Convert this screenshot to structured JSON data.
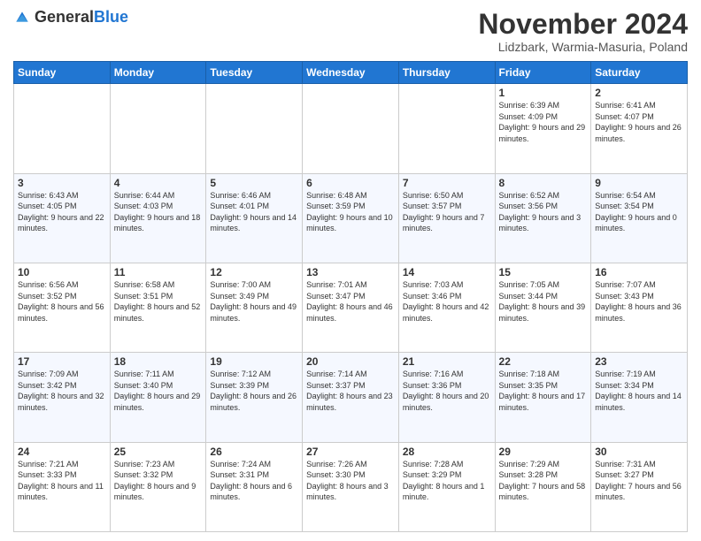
{
  "header": {
    "logo_general": "General",
    "logo_blue": "Blue",
    "month_title": "November 2024",
    "location": "Lidzbark, Warmia-Masuria, Poland"
  },
  "days_of_week": [
    "Sunday",
    "Monday",
    "Tuesday",
    "Wednesday",
    "Thursday",
    "Friday",
    "Saturday"
  ],
  "weeks": [
    [
      {
        "day": "",
        "info": ""
      },
      {
        "day": "",
        "info": ""
      },
      {
        "day": "",
        "info": ""
      },
      {
        "day": "",
        "info": ""
      },
      {
        "day": "",
        "info": ""
      },
      {
        "day": "1",
        "info": "Sunrise: 6:39 AM\nSunset: 4:09 PM\nDaylight: 9 hours and 29 minutes."
      },
      {
        "day": "2",
        "info": "Sunrise: 6:41 AM\nSunset: 4:07 PM\nDaylight: 9 hours and 26 minutes."
      }
    ],
    [
      {
        "day": "3",
        "info": "Sunrise: 6:43 AM\nSunset: 4:05 PM\nDaylight: 9 hours and 22 minutes."
      },
      {
        "day": "4",
        "info": "Sunrise: 6:44 AM\nSunset: 4:03 PM\nDaylight: 9 hours and 18 minutes."
      },
      {
        "day": "5",
        "info": "Sunrise: 6:46 AM\nSunset: 4:01 PM\nDaylight: 9 hours and 14 minutes."
      },
      {
        "day": "6",
        "info": "Sunrise: 6:48 AM\nSunset: 3:59 PM\nDaylight: 9 hours and 10 minutes."
      },
      {
        "day": "7",
        "info": "Sunrise: 6:50 AM\nSunset: 3:57 PM\nDaylight: 9 hours and 7 minutes."
      },
      {
        "day": "8",
        "info": "Sunrise: 6:52 AM\nSunset: 3:56 PM\nDaylight: 9 hours and 3 minutes."
      },
      {
        "day": "9",
        "info": "Sunrise: 6:54 AM\nSunset: 3:54 PM\nDaylight: 9 hours and 0 minutes."
      }
    ],
    [
      {
        "day": "10",
        "info": "Sunrise: 6:56 AM\nSunset: 3:52 PM\nDaylight: 8 hours and 56 minutes."
      },
      {
        "day": "11",
        "info": "Sunrise: 6:58 AM\nSunset: 3:51 PM\nDaylight: 8 hours and 52 minutes."
      },
      {
        "day": "12",
        "info": "Sunrise: 7:00 AM\nSunset: 3:49 PM\nDaylight: 8 hours and 49 minutes."
      },
      {
        "day": "13",
        "info": "Sunrise: 7:01 AM\nSunset: 3:47 PM\nDaylight: 8 hours and 46 minutes."
      },
      {
        "day": "14",
        "info": "Sunrise: 7:03 AM\nSunset: 3:46 PM\nDaylight: 8 hours and 42 minutes."
      },
      {
        "day": "15",
        "info": "Sunrise: 7:05 AM\nSunset: 3:44 PM\nDaylight: 8 hours and 39 minutes."
      },
      {
        "day": "16",
        "info": "Sunrise: 7:07 AM\nSunset: 3:43 PM\nDaylight: 8 hours and 36 minutes."
      }
    ],
    [
      {
        "day": "17",
        "info": "Sunrise: 7:09 AM\nSunset: 3:42 PM\nDaylight: 8 hours and 32 minutes."
      },
      {
        "day": "18",
        "info": "Sunrise: 7:11 AM\nSunset: 3:40 PM\nDaylight: 8 hours and 29 minutes."
      },
      {
        "day": "19",
        "info": "Sunrise: 7:12 AM\nSunset: 3:39 PM\nDaylight: 8 hours and 26 minutes."
      },
      {
        "day": "20",
        "info": "Sunrise: 7:14 AM\nSunset: 3:37 PM\nDaylight: 8 hours and 23 minutes."
      },
      {
        "day": "21",
        "info": "Sunrise: 7:16 AM\nSunset: 3:36 PM\nDaylight: 8 hours and 20 minutes."
      },
      {
        "day": "22",
        "info": "Sunrise: 7:18 AM\nSunset: 3:35 PM\nDaylight: 8 hours and 17 minutes."
      },
      {
        "day": "23",
        "info": "Sunrise: 7:19 AM\nSunset: 3:34 PM\nDaylight: 8 hours and 14 minutes."
      }
    ],
    [
      {
        "day": "24",
        "info": "Sunrise: 7:21 AM\nSunset: 3:33 PM\nDaylight: 8 hours and 11 minutes."
      },
      {
        "day": "25",
        "info": "Sunrise: 7:23 AM\nSunset: 3:32 PM\nDaylight: 8 hours and 9 minutes."
      },
      {
        "day": "26",
        "info": "Sunrise: 7:24 AM\nSunset: 3:31 PM\nDaylight: 8 hours and 6 minutes."
      },
      {
        "day": "27",
        "info": "Sunrise: 7:26 AM\nSunset: 3:30 PM\nDaylight: 8 hours and 3 minutes."
      },
      {
        "day": "28",
        "info": "Sunrise: 7:28 AM\nSunset: 3:29 PM\nDaylight: 8 hours and 1 minute."
      },
      {
        "day": "29",
        "info": "Sunrise: 7:29 AM\nSunset: 3:28 PM\nDaylight: 7 hours and 58 minutes."
      },
      {
        "day": "30",
        "info": "Sunrise: 7:31 AM\nSunset: 3:27 PM\nDaylight: 7 hours and 56 minutes."
      }
    ]
  ]
}
